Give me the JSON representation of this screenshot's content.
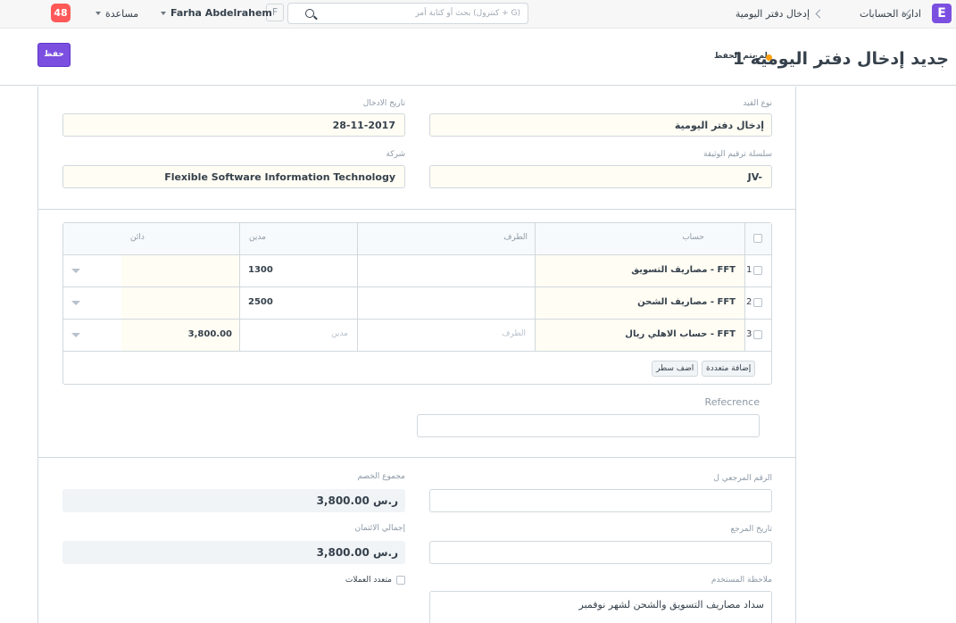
{
  "navbar": {
    "app_letter": "E",
    "breadcrumbs": [
      "ادارة الحسابات",
      "إدخال دفتر اليومية"
    ],
    "search_placeholder": "بحث أو كتابة أمر (كنترول + G)",
    "avatar_letter": "F",
    "user_name": "Farha Abdelrahem",
    "help_label": "مساعدة",
    "notification_count": "48"
  },
  "page": {
    "title": "جديد إدخال دفتر اليومية 1",
    "status": "لم يتم الحفظ",
    "save_label": "حفظ"
  },
  "form": {
    "entry_type_label": "نوع القيد",
    "entry_type_value": "إدخال دفتر اليومية",
    "posting_date_label": "تاريخ الادخال",
    "posting_date_value": "28-11-2017",
    "series_label": "سلسلة ترقيم الوثيقة",
    "series_value": "JV-",
    "company_label": "شركة",
    "company_value": "Flexible Software Information Technology"
  },
  "accounts_table": {
    "headers": {
      "account": "حساب",
      "party": "الطرف",
      "debit": "مدين",
      "credit": "دائن"
    },
    "rows": [
      {
        "idx": "1",
        "account": "مصاريف التسويق - FFT",
        "party": "",
        "debit": "1300",
        "credit": ""
      },
      {
        "idx": "2",
        "account": "مصاريف الشحن - FFT",
        "party": "",
        "debit": "2500",
        "credit": ""
      },
      {
        "idx": "3",
        "account": "حساب الاهلي ريال - FFT",
        "party": "الطرف",
        "debit": "مدين",
        "credit": "3,800.00"
      }
    ],
    "add_multiple_label": "إضافة متعددة",
    "add_row_label": "اضف سطر"
  },
  "reference": {
    "label": "Refecrence",
    "value": ""
  },
  "totals": {
    "ref_no_label": "الرقم المرجعي ل",
    "ref_no_value": "",
    "total_debit_label": "مجموع الخصم",
    "total_debit_value": "ر.س 3,800.00",
    "ref_date_label": "تاريخ المرجع",
    "ref_date_value": "",
    "total_credit_label": "إجمالي الائتمان",
    "total_credit_value": "ر.س 3,800.00",
    "user_remark_label": "ملاحظة المستخدم",
    "user_remark_value": "سداد مصاريف التسويق والشحن لشهر نوفمبر",
    "multi_currency_label": "متعدد العملات"
  },
  "colors": {
    "primary": "#7b4fe0",
    "badge": "#ff5858",
    "indicator": "#ffa00a"
  }
}
